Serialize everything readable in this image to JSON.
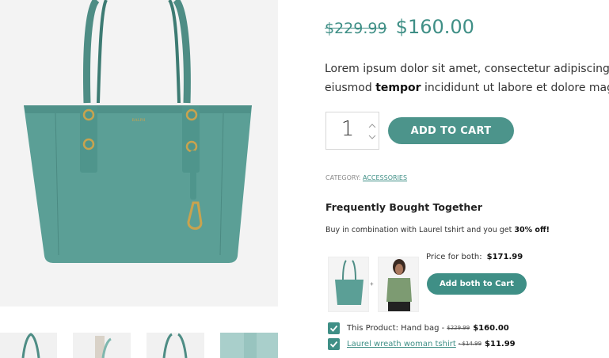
{
  "product": {
    "old_price": "$229.99",
    "new_price": "$160.00",
    "description_pre": "Lorem ipsum dolor sit amet, consectetur adipiscing ",
    "description_line2_pre": "eiusmod ",
    "description_bold": "tempor",
    "description_line2_post": " incididunt ut labore et dolore mag",
    "quantity": "1",
    "add_to_cart_label": "ADD TO CART",
    "category_label": "CATEGORY:",
    "category_value": "ACCESSORIES",
    "brand_text_on_bag": "RALPH"
  },
  "fbt": {
    "title": "Frequently Bought Together",
    "subtitle_pre": "Buy in combination with Laurel tshirt and you get ",
    "subtitle_bold": "30% off!",
    "plus": "+",
    "price_both_label": "Price for both:",
    "price_both_value": "$171.99",
    "add_both_label": "Add both to Cart",
    "items": [
      {
        "label": "This Product: Hand bag - ",
        "old": "$229.99",
        "new": "$160.00",
        "checked": true
      },
      {
        "label": "Laurel wreath woman tshirt ",
        "old": "- $14.99",
        "new": "$11.99",
        "checked": true
      }
    ]
  },
  "colors": {
    "accent": "#3f8f86",
    "bag": "#5b9f96",
    "gallery_bg": "#f3f3f3"
  },
  "icons": [
    "check-icon",
    "chevron-up-icon",
    "chevron-down-icon"
  ]
}
